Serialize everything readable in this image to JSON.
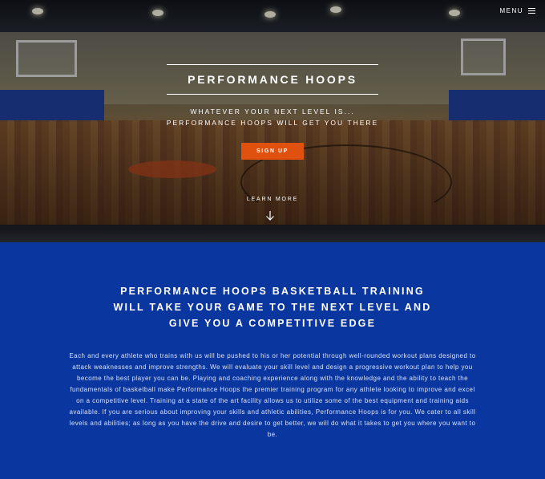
{
  "nav": {
    "menu_label": "MENU",
    "menu_icon": "hamburger-icon"
  },
  "hero": {
    "title": "PERFORMANCE HOOPS",
    "tagline_line1": "WHATEVER YOUR NEXT LEVEL IS...",
    "tagline_line2": "PERFORMANCE HOOPS WILL GET YOU THERE",
    "signup_label": "SIGN UP",
    "learn_more_label": "LEARN MORE",
    "learn_more_icon": "arrow-down-icon",
    "button_color": "#e0500e"
  },
  "intro": {
    "heading_line1": "PERFORMANCE HOOPS BASKETBALL TRAINING",
    "heading_line2": "WILL TAKE YOUR GAME TO THE NEXT LEVEL AND",
    "heading_line3": "GIVE YOU A COMPETITIVE EDGE",
    "body": "Each and every athlete who trains with us will be pushed to his or her potential through well-rounded workout plans designed to attack weaknesses and improve strengths. We will evaluate your skill level and design a progressive workout plan to help you become the best player you can be. Playing and coaching experience along with the knowledge and the ability to teach the fundamentals of basketball make Performance Hoops the premier training program for any athlete looking to improve and excel on a competitive level. Training at a state of the art facility allows us to utilize some of the best equipment and training aids available. If you are serious about improving your skills and athletic abilities, Performance Hoops is for you. We cater to all skill levels and abilities; as long as you have the drive and desire to get better, we will do what it takes to get you where you want to be.",
    "background_color": "#0a36a0"
  }
}
